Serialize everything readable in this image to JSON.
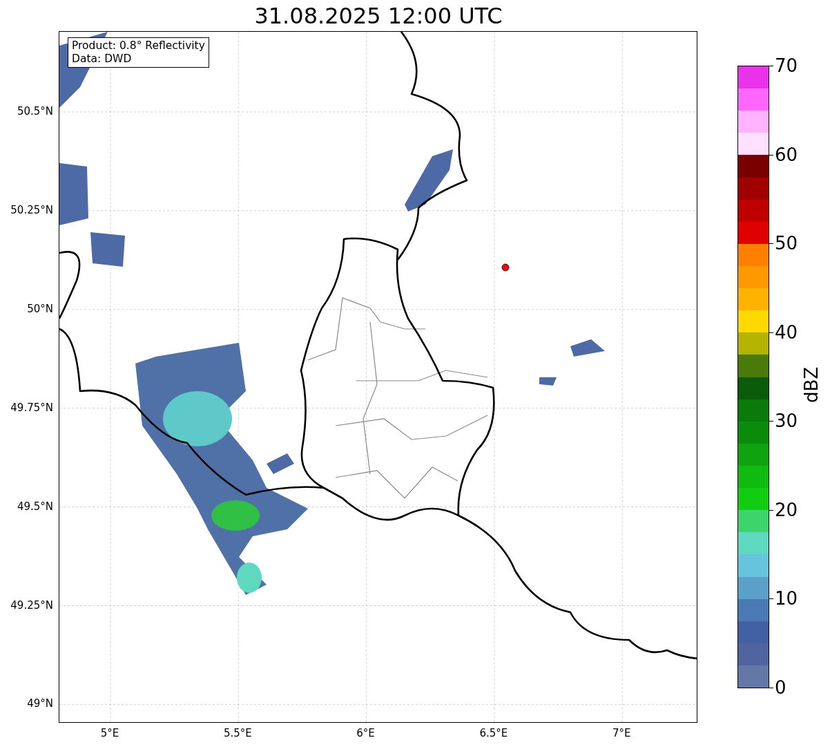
{
  "title": "31.08.2025 12:00 UTC",
  "info_box": [
    "Product: 0.8° Reflectivity",
    "Data: DWD"
  ],
  "lat_labels": [
    "50.5°N",
    "50.25°N",
    "50°N",
    "49.75°N",
    "49.5°N",
    "49.25°N",
    "49°N"
  ],
  "lon_labels": [
    "5°E",
    "5.5°E",
    "6°E",
    "6.5°E",
    "7°E"
  ],
  "colorbar": {
    "label": "dBZ",
    "ticks": [
      "70",
      "60",
      "50",
      "40",
      "30",
      "20",
      "10",
      "0"
    ],
    "bands": [
      {
        "color": "#e932e9"
      },
      {
        "color": "#ff66ff"
      },
      {
        "color": "#ffb3ff"
      },
      {
        "color": "#ffe0ff"
      },
      {
        "color": "#7a0000"
      },
      {
        "color": "#a00000"
      },
      {
        "color": "#c00000"
      },
      {
        "color": "#e00000"
      },
      {
        "color": "#ff7f00"
      },
      {
        "color": "#ff9900"
      },
      {
        "color": "#ffb300"
      },
      {
        "color": "#ffd900"
      },
      {
        "color": "#b3b300"
      },
      {
        "color": "#4a7a0a"
      },
      {
        "color": "#0a5c0a"
      },
      {
        "color": "#0a7a0a"
      },
      {
        "color": "#0a8c0a"
      },
      {
        "color": "#0fa30f"
      },
      {
        "color": "#10bb10"
      },
      {
        "color": "#12cc12"
      },
      {
        "color": "#3dd46b"
      },
      {
        "color": "#5fd8c0"
      },
      {
        "color": "#66c4dc"
      },
      {
        "color": "#5aa0c8"
      },
      {
        "color": "#4a7ab4"
      },
      {
        "color": "#4260a4"
      },
      {
        "color": "#5065a0"
      },
      {
        "color": "#6478a8"
      }
    ]
  }
}
